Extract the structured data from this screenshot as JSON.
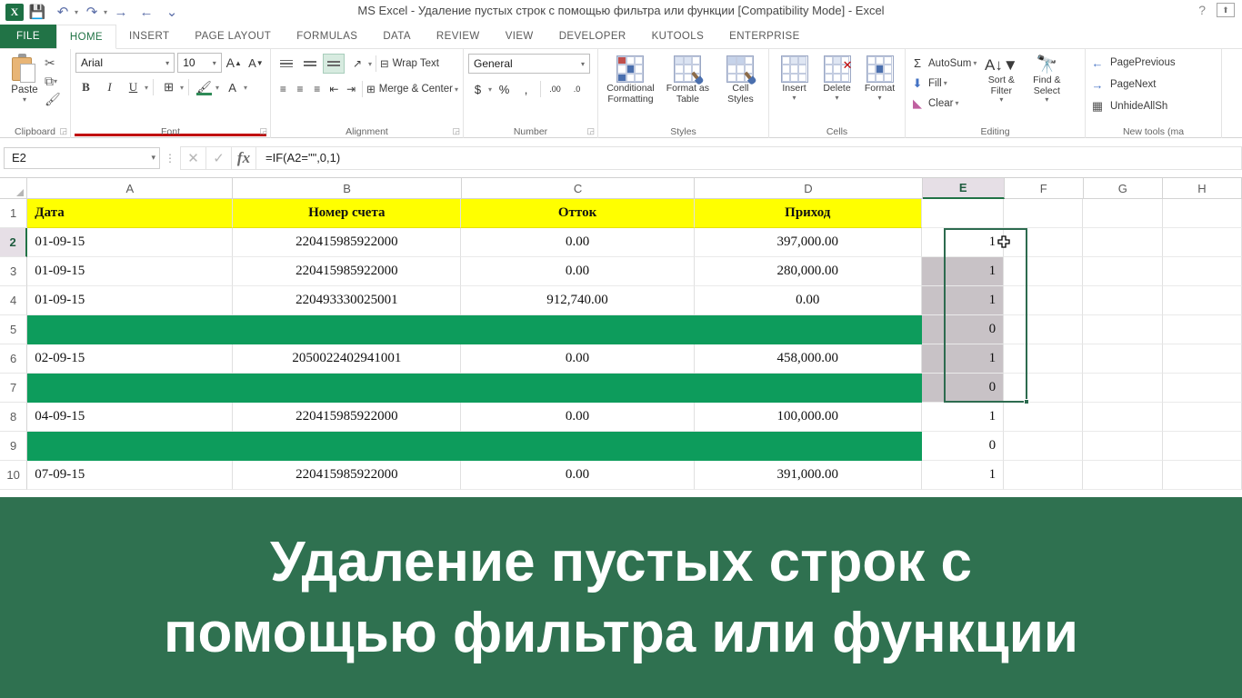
{
  "window": {
    "title": "MS Excel - Удаление пустых строк с помощью фильтра или функции  [Compatibility Mode] - Excel",
    "help_icon": "?",
    "ribbon_display_icon": "ribbon-display-options-icon"
  },
  "quick_access": {
    "logo": "X",
    "items": [
      {
        "name": "save",
        "glyph": "💾"
      },
      {
        "name": "undo",
        "glyph": "↶"
      },
      {
        "name": "redo",
        "glyph": "↷"
      },
      {
        "name": "forward",
        "glyph": "→"
      },
      {
        "name": "back",
        "glyph": "←"
      },
      {
        "name": "customize",
        "glyph": "⌄"
      }
    ]
  },
  "tabs": [
    {
      "label": "FILE",
      "kind": "file"
    },
    {
      "label": "HOME",
      "kind": "active"
    },
    {
      "label": "INSERT",
      "kind": "normal"
    },
    {
      "label": "PAGE LAYOUT",
      "kind": "normal"
    },
    {
      "label": "FORMULAS",
      "kind": "normal"
    },
    {
      "label": "DATA",
      "kind": "normal"
    },
    {
      "label": "REVIEW",
      "kind": "normal"
    },
    {
      "label": "VIEW",
      "kind": "normal"
    },
    {
      "label": "DEVELOPER",
      "kind": "normal"
    },
    {
      "label": "KUTOOLS",
      "kind": "normal"
    },
    {
      "label": "ENTERPRISE",
      "kind": "normal"
    }
  ],
  "ribbon": {
    "clipboard": {
      "label": "Clipboard",
      "paste": "Paste",
      "cut": "✂",
      "copy": "⧉",
      "format_painter": "🖌"
    },
    "font": {
      "label": "Font",
      "font_name": "Arial",
      "font_size": "10",
      "grow": "A",
      "shrink": "A",
      "bold": "B",
      "italic": "I",
      "underline": "U",
      "borders": "⊞",
      "fill_color": "A",
      "font_color": "A"
    },
    "alignment": {
      "label": "Alignment",
      "wrap_text": "Wrap Text",
      "merge_center": "Merge & Center",
      "orientation": "↗",
      "decrease_indent": "⇤",
      "increase_indent": "⇥"
    },
    "number": {
      "label": "Number",
      "format": "General",
      "currency": "$",
      "percent": "%",
      "comma": ",",
      "increase_decimal": ".00",
      "decrease_decimal": ".0"
    },
    "styles": {
      "label": "Styles",
      "conditional_formatting": "Conditional Formatting",
      "format_as_table": "Format as Table",
      "cell_styles": "Cell Styles"
    },
    "cells": {
      "label": "Cells",
      "insert": "Insert",
      "delete": "Delete",
      "format": "Format"
    },
    "editing": {
      "label": "Editing",
      "autosum": "AutoSum",
      "fill": "Fill",
      "clear": "Clear",
      "sort_filter": "Sort & Filter",
      "find_select": "Find & Select"
    },
    "new_tools": {
      "label": "New tools (ma",
      "page_previous": "PagePrevious",
      "page_next": "PageNext",
      "unhide_all": "UnhideAllSh"
    }
  },
  "formula_bar": {
    "name_box": "E2",
    "cancel_icon": "✕",
    "enter_icon": "✓",
    "fx_icon": "fx",
    "formula": "=IF(A2=\"\",0,1)"
  },
  "sheet": {
    "columns": [
      "A",
      "B",
      "C",
      "D",
      "E",
      "F",
      "G",
      "H"
    ],
    "selected_column": "E",
    "selected_row": "2",
    "selection_range": "E2:E7",
    "row_numbers": [
      "1",
      "2",
      "3",
      "4",
      "5",
      "6",
      "7",
      "8",
      "9",
      "10"
    ],
    "header_row": {
      "A": "Дата",
      "B": "Номер счета",
      "C": "Отток",
      "D": "Приход",
      "E": ""
    },
    "rows": [
      {
        "row": "2",
        "blank": false,
        "A": "01-09-15",
        "B": "220415985922000",
        "C": "0.00",
        "D": "397,000.00",
        "E": "1"
      },
      {
        "row": "3",
        "blank": false,
        "A": "01-09-15",
        "B": "220415985922000",
        "C": "0.00",
        "D": "280,000.00",
        "E": "1"
      },
      {
        "row": "4",
        "blank": false,
        "A": "01-09-15",
        "B": "220493330025001",
        "C": "912,740.00",
        "D": "0.00",
        "E": "1"
      },
      {
        "row": "5",
        "blank": true,
        "A": "",
        "B": "",
        "C": "",
        "D": "",
        "E": "0"
      },
      {
        "row": "6",
        "blank": false,
        "A": "02-09-15",
        "B": "2050022402941001",
        "C": "0.00",
        "D": "458,000.00",
        "E": "1"
      },
      {
        "row": "7",
        "blank": true,
        "A": "",
        "B": "",
        "C": "",
        "D": "",
        "E": "0"
      },
      {
        "row": "8",
        "blank": false,
        "A": "04-09-15",
        "B": "220415985922000",
        "C": "0.00",
        "D": "100,000.00",
        "E": "1"
      },
      {
        "row": "9",
        "blank": true,
        "A": "",
        "B": "",
        "C": "",
        "D": "",
        "E": "0"
      },
      {
        "row": "10",
        "blank": false,
        "A": "07-09-15",
        "B": "220415985922000",
        "C": "0.00",
        "D": "391,000.00",
        "E": "1"
      }
    ],
    "colors": {
      "header_fill": "#ffff00",
      "blank_row_fill": "#0d9c5c",
      "selection_fill": "#c8c2c6",
      "selection_border": "#2d6b4f"
    }
  },
  "caption": {
    "line1": "Удаление пустых строк с",
    "line2": "помощью фильтра или функции",
    "background": "#2f7150",
    "color": "#ffffff"
  }
}
